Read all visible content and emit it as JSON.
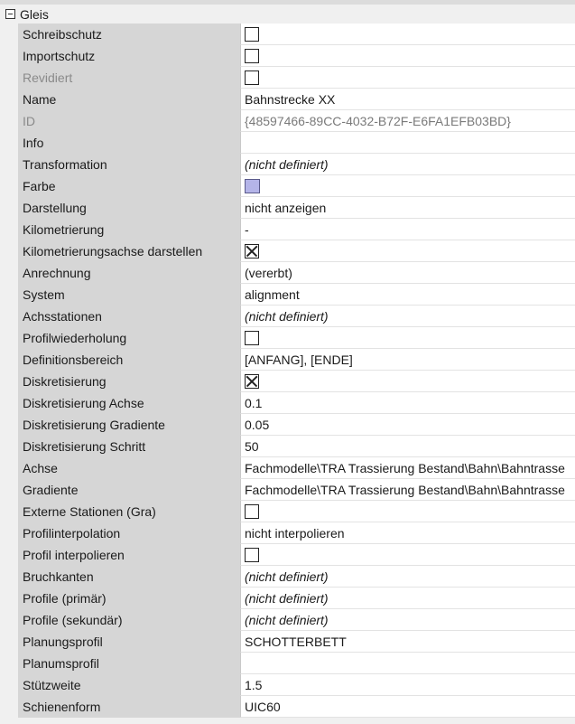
{
  "category": {
    "label": "Gleis"
  },
  "rows": [
    {
      "key": "schreibschutz",
      "label": "Schreibschutz",
      "type": "checkbox",
      "checked": false
    },
    {
      "key": "importschutz",
      "label": "Importschutz",
      "type": "checkbox",
      "checked": false
    },
    {
      "key": "revidiert",
      "label": "Revidiert",
      "type": "checkbox",
      "checked": false,
      "dim": true
    },
    {
      "key": "name",
      "label": "Name",
      "type": "text",
      "value": "Bahnstrecke XX"
    },
    {
      "key": "id",
      "label": "ID",
      "type": "text",
      "value": "{48597466-89CC-4032-B72F-E6FA1EFB03BD}",
      "dim": true
    },
    {
      "key": "info",
      "label": "Info",
      "type": "text",
      "value": ""
    },
    {
      "key": "transformation",
      "label": "Transformation",
      "type": "text",
      "value": "(nicht definiert)",
      "italic": true
    },
    {
      "key": "farbe",
      "label": "Farbe",
      "type": "color",
      "color": "#b4b4e8"
    },
    {
      "key": "darstellung",
      "label": "Darstellung",
      "type": "text",
      "value": "nicht anzeigen"
    },
    {
      "key": "kilometrierung",
      "label": "Kilometrierung",
      "type": "text",
      "value": "-"
    },
    {
      "key": "kilometrierungsachse-darstellen",
      "label": "Kilometrierungsachse darstellen",
      "type": "checkbox",
      "checked": true
    },
    {
      "key": "anrechnung",
      "label": "Anrechnung",
      "type": "text",
      "value": "(vererbt)"
    },
    {
      "key": "system",
      "label": "System",
      "type": "text",
      "value": "alignment"
    },
    {
      "key": "achsstationen",
      "label": "Achsstationen",
      "type": "text",
      "value": "(nicht definiert)",
      "italic": true
    },
    {
      "key": "profilwiederholung",
      "label": "Profilwiederholung",
      "type": "checkbox",
      "checked": false
    },
    {
      "key": "definitionsbereich",
      "label": "Definitionsbereich",
      "type": "text",
      "value": "[ANFANG], [ENDE]"
    },
    {
      "key": "diskretisierung",
      "label": "Diskretisierung",
      "type": "checkbox",
      "checked": true
    },
    {
      "key": "diskretisierung-achse",
      "label": "Diskretisierung Achse",
      "type": "text",
      "value": "0.1"
    },
    {
      "key": "diskretisierung-gradiente",
      "label": "Diskretisierung Gradiente",
      "type": "text",
      "value": "0.05"
    },
    {
      "key": "diskretisierung-schritt",
      "label": "Diskretisierung Schritt",
      "type": "text",
      "value": "50"
    },
    {
      "key": "achse",
      "label": "Achse",
      "type": "text",
      "value": "Fachmodelle\\TRA Trassierung Bestand\\Bahn\\Bahntrasse"
    },
    {
      "key": "gradiente",
      "label": "Gradiente",
      "type": "text",
      "value": "Fachmodelle\\TRA Trassierung Bestand\\Bahn\\Bahntrasse"
    },
    {
      "key": "externe-stationen",
      "label": "Externe Stationen (Gra)",
      "type": "checkbox",
      "checked": false
    },
    {
      "key": "profilinterpolation",
      "label": "Profilinterpolation",
      "type": "text",
      "value": "nicht interpolieren"
    },
    {
      "key": "profil-interpolieren",
      "label": "Profil interpolieren",
      "type": "checkbox",
      "checked": false
    },
    {
      "key": "bruchkanten",
      "label": "Bruchkanten",
      "type": "text",
      "value": "(nicht definiert)",
      "italic": true
    },
    {
      "key": "profile-primaer",
      "label": "Profile (primär)",
      "type": "text",
      "value": "(nicht definiert)",
      "italic": true
    },
    {
      "key": "profile-sekundaer",
      "label": "Profile (sekundär)",
      "type": "text",
      "value": "(nicht definiert)",
      "italic": true
    },
    {
      "key": "planungsprofil",
      "label": "Planungsprofil",
      "type": "text",
      "value": "SCHOTTERBETT"
    },
    {
      "key": "planumsprofil",
      "label": "Planumsprofil",
      "type": "text",
      "value": ""
    },
    {
      "key": "stuetzweite",
      "label": "Stützweite",
      "type": "text",
      "value": "1.5"
    },
    {
      "key": "schienenform",
      "label": "Schienenform",
      "type": "text",
      "value": "UIC60"
    }
  ]
}
